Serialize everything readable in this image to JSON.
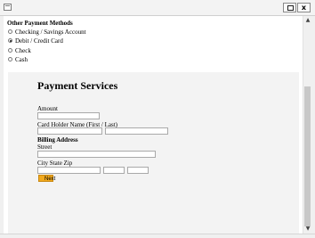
{
  "window": {
    "icon": "window-icon",
    "restore_label": "",
    "close_label": "x"
  },
  "other_methods": {
    "title": "Other Payment Methods",
    "options": [
      {
        "label": "Checking / Savings Account",
        "checked": false
      },
      {
        "label": "Debit / Credit Card",
        "checked": true
      },
      {
        "label": "Check",
        "checked": false
      },
      {
        "label": "Cash",
        "checked": false
      }
    ]
  },
  "payment_services": {
    "heading": "Payment Services",
    "amount_label": "Amount",
    "cardholder_label": "Card Holder Name (First / Last)",
    "billing_label": "Billing Address",
    "street_label": "Street",
    "city_state_zip_label": "City State Zip",
    "next_label": "Next",
    "amount_value": "",
    "first_name_value": "",
    "last_name_value": "",
    "street_value": "",
    "city_value": "",
    "state_value": "",
    "zip_value": ""
  },
  "colors": {
    "next_button": "#f2a91d",
    "panel": "#f3f3f3",
    "scroll_thumb": "#c8c8c8"
  }
}
